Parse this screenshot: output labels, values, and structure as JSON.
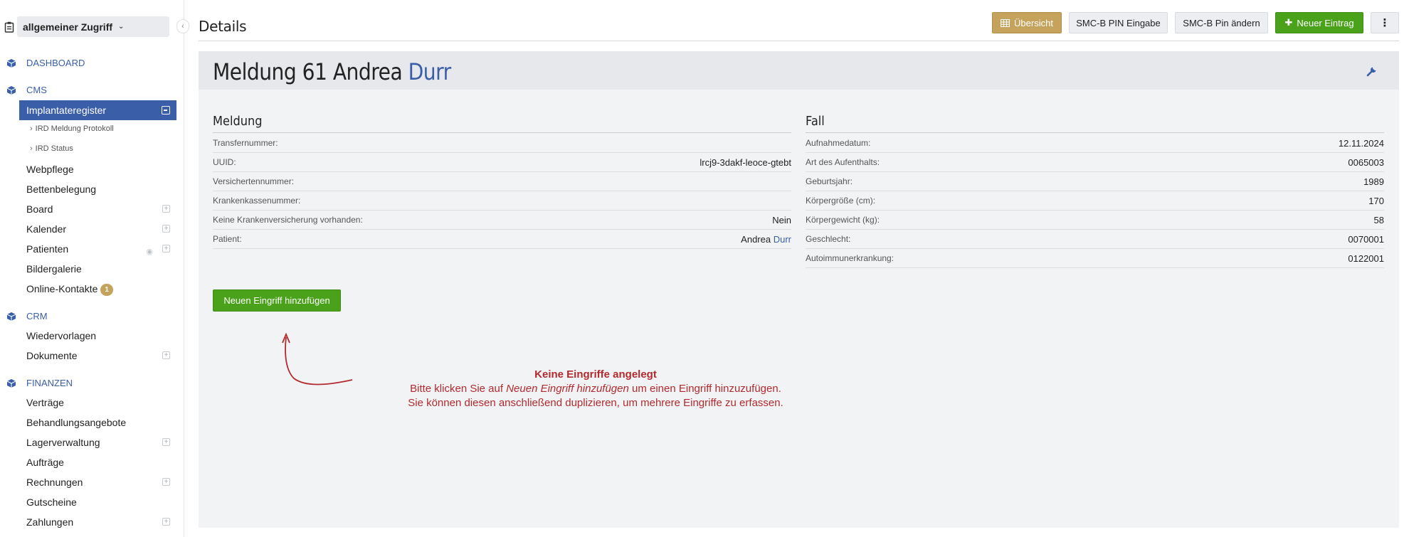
{
  "sidebar": {
    "context_label": "allgemeiner Zugriff",
    "sections": {
      "dashboard": "DASHBOARD",
      "cms": "CMS",
      "crm": "CRM",
      "finanzen": "FINANZEN"
    },
    "items": {
      "implantateregister": "Implantateregister",
      "ird_meldung_protokoll": "IRD Meldung Protokoll",
      "ird_status": "IRD Status",
      "webpflege": "Webpflege",
      "bettenbelegung": "Bettenbelegung",
      "board": "Board",
      "kalender": "Kalender",
      "patienten": "Patienten",
      "bildergalerie": "Bildergalerie",
      "online_kontakte": "Online-Kontakte",
      "online_kontakte_badge": "1",
      "wiedervorlagen": "Wiedervorlagen",
      "dokumente": "Dokumente",
      "vertraege": "Verträge",
      "behandlungsangebote": "Behandlungsangebote",
      "lagerverwaltung": "Lagerverwaltung",
      "auftraege": "Aufträge",
      "rechnungen": "Rechnungen",
      "gutscheine": "Gutscheine",
      "zahlungen": "Zahlungen"
    }
  },
  "header": {
    "title": "Details",
    "buttons": {
      "uebersicht": "Übersicht",
      "smcb_pin_eingabe": "SMC-B PIN Eingabe",
      "smcb_pin_aendern": "SMC-B Pin ändern",
      "neuer_eintrag": "Neuer Eintrag"
    }
  },
  "record": {
    "title_prefix": "Meldung 61 Andrea",
    "title_link": "Durr",
    "meldung": {
      "heading": "Meldung",
      "rows": [
        {
          "label": "Transfernummer:",
          "value": ""
        },
        {
          "label": "UUID:",
          "value": "lrcj9-3dakf-leoce-gtebt"
        },
        {
          "label": "Versichertennummer:",
          "value": ""
        },
        {
          "label": "Krankenkassenummer:",
          "value": ""
        },
        {
          "label": "Keine Krankenversicherung vorhanden:",
          "value": "Nein"
        },
        {
          "label": "Patient:",
          "value": "Andrea",
          "link": "Durr"
        }
      ]
    },
    "fall": {
      "heading": "Fall",
      "rows": [
        {
          "label": "Aufnahmedatum:",
          "value": "12.11.2024"
        },
        {
          "label": "Art des Aufenthalts:",
          "value": "0065003"
        },
        {
          "label": "Geburtsjahr:",
          "value": "1989"
        },
        {
          "label": "Körpergröße (cm):",
          "value": "170"
        },
        {
          "label": "Körpergewicht (kg):",
          "value": "58"
        },
        {
          "label": "Geschlecht:",
          "value": "0070001"
        },
        {
          "label": "Autoimmunerkrankung:",
          "value": "0122001"
        }
      ]
    },
    "add_button": "Neuen Eingriff hinzufügen",
    "hint": {
      "title": "Keine Eingriffe angelegt",
      "line1_pre": "Bitte klicken Sie auf ",
      "line1_em": "Neuen Eingriff hinzufügen",
      "line1_post": " um einen Eingriff hinzuzufügen.",
      "line2": "Sie können diesen anschließend duplizieren, um mehrere Eingriffe zu erfassen."
    }
  },
  "colors": {
    "accent_blue": "#3a5ea8",
    "gold": "#c5a35c",
    "green": "#4aa21a",
    "hint_red": "#b22a2e"
  }
}
